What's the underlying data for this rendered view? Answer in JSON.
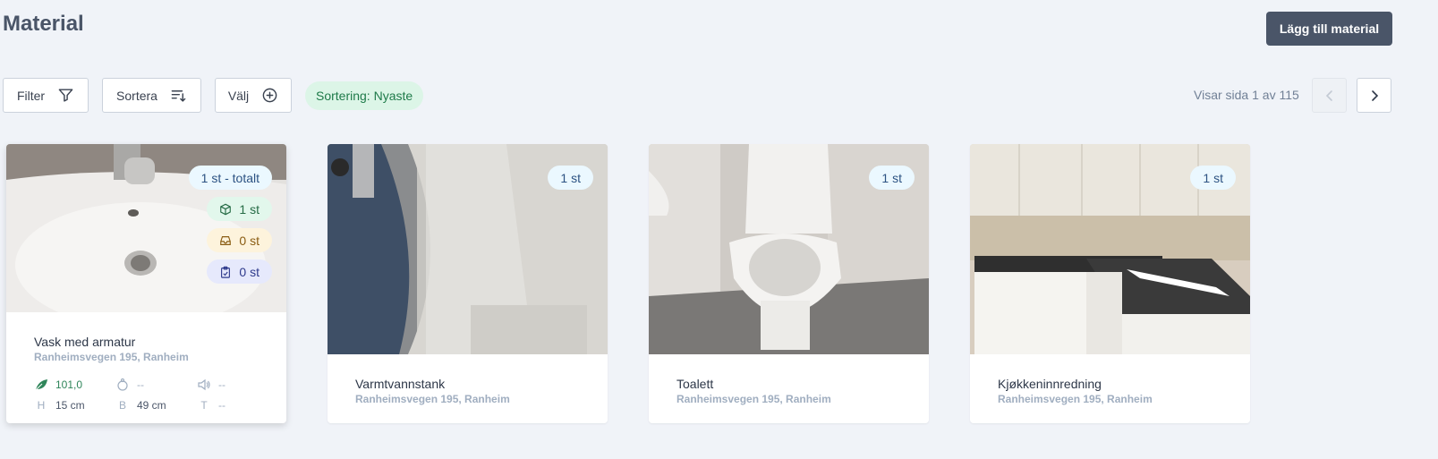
{
  "page": {
    "title": "Material"
  },
  "header": {
    "add_button": "Lägg till material"
  },
  "toolbar": {
    "filter_label": "Filter",
    "sort_label": "Sortera",
    "select_label": "Välj",
    "sort_chip": "Sortering: Nyaste",
    "page_info": "Visar sida 1 av 115"
  },
  "cards": [
    {
      "title": "Vask med armatur",
      "address": "Ranheimsvegen 195, Ranheim",
      "badges": {
        "total": "1 st - totalt",
        "available": "1 st",
        "reserved": "0 st",
        "used": "0 st"
      },
      "stats": {
        "co2": "101,0",
        "weight": "--",
        "sound": "--",
        "h_key": "H",
        "h_val": "15 cm",
        "b_key": "B",
        "b_val": "49 cm",
        "t_key": "T",
        "t_val": "--"
      }
    },
    {
      "title": "Varmtvannstank",
      "address": "Ranheimsvegen 195, Ranheim",
      "badge": "1 st"
    },
    {
      "title": "Toalett",
      "address": "Ranheimsvegen 195, Ranheim",
      "badge": "1 st"
    },
    {
      "title": "Kjøkkeninnredning",
      "address": "Ranheimsvegen 195, Ranheim",
      "badge": "1 st"
    }
  ],
  "colors": {
    "primary": "#4a5568",
    "chip_bg": "#dcf5e7",
    "chip_text": "#1e7a49",
    "badge_bg": "#ebf8ff"
  },
  "icons": [
    "funnel-icon",
    "sort-icon",
    "plus-circle-icon",
    "chevron-left-icon",
    "chevron-right-icon",
    "box-icon",
    "tray-icon",
    "clipboard-icon",
    "leaf-icon",
    "weight-icon",
    "sound-icon"
  ]
}
